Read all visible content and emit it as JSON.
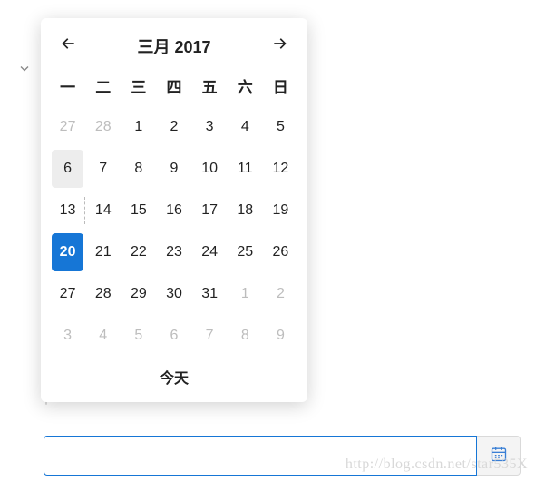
{
  "calendar": {
    "title": "三月 2017",
    "prev_icon": "arrow-left-icon",
    "next_icon": "arrow-right-icon",
    "weekdays": [
      "一",
      "二",
      "三",
      "四",
      "五",
      "六",
      "日"
    ],
    "days": [
      {
        "n": 27,
        "muted": true
      },
      {
        "n": 28,
        "muted": true
      },
      {
        "n": 1
      },
      {
        "n": 2
      },
      {
        "n": 3
      },
      {
        "n": 4
      },
      {
        "n": 5
      },
      {
        "n": 6,
        "today": true
      },
      {
        "n": 7
      },
      {
        "n": 8
      },
      {
        "n": 9
      },
      {
        "n": 10
      },
      {
        "n": 11
      },
      {
        "n": 12
      },
      {
        "n": 13,
        "dashed": true
      },
      {
        "n": 14
      },
      {
        "n": 15
      },
      {
        "n": 16
      },
      {
        "n": 17
      },
      {
        "n": 18
      },
      {
        "n": 19
      },
      {
        "n": 20,
        "selected": true
      },
      {
        "n": 21
      },
      {
        "n": 22
      },
      {
        "n": 23
      },
      {
        "n": 24
      },
      {
        "n": 25
      },
      {
        "n": 26
      },
      {
        "n": 27
      },
      {
        "n": 28
      },
      {
        "n": 29
      },
      {
        "n": 30
      },
      {
        "n": 31
      },
      {
        "n": 1,
        "muted": true
      },
      {
        "n": 2,
        "muted": true
      },
      {
        "n": 3,
        "muted": true
      },
      {
        "n": 4,
        "muted": true
      },
      {
        "n": 5,
        "muted": true
      },
      {
        "n": 6,
        "muted": true
      },
      {
        "n": 7,
        "muted": true
      },
      {
        "n": 8,
        "muted": true
      },
      {
        "n": 9,
        "muted": true
      }
    ],
    "footer_label": "今天"
  },
  "date_field": {
    "value": "",
    "placeholder": ""
  },
  "watermark": "http://blog.csdn.net/star535X"
}
